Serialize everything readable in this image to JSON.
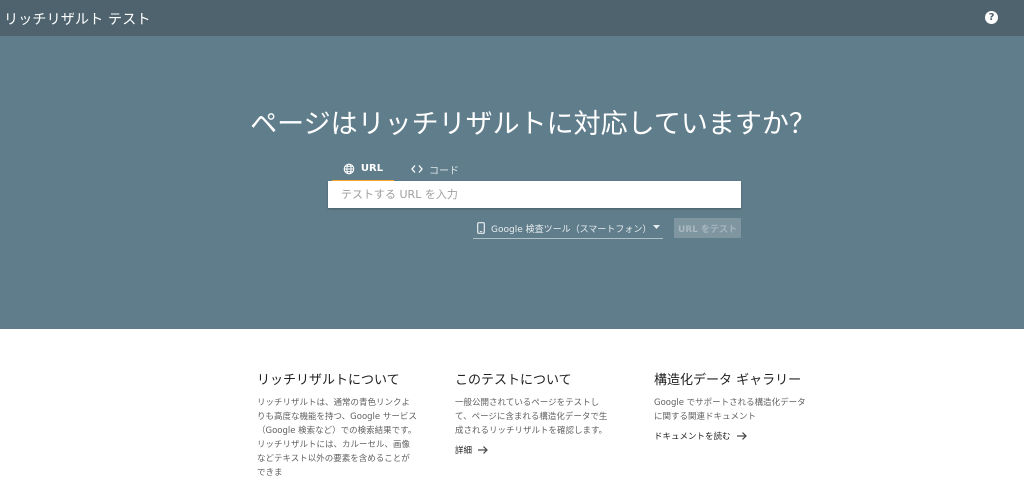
{
  "header": {
    "app_title": "リッチリザルト テスト",
    "help_icon": "help-circle-icon",
    "help_glyph": "?"
  },
  "hero": {
    "title": "ページはリッチリザルトに対応していますか？",
    "tabs": [
      {
        "label": "URL",
        "icon": "globe-icon",
        "active": true
      },
      {
        "label": "コード",
        "icon": "code-icon",
        "active": false
      }
    ],
    "url_input": {
      "placeholder": "テストする URL を入力",
      "value": ""
    },
    "device_select": {
      "selected": "Google 検査ツール（スマートフォン）",
      "icon": "smartphone-icon"
    },
    "test_button_label": "URL をテスト"
  },
  "info_sections": [
    {
      "title": "リッチリザルトについて",
      "body": "リッチリザルトは、通常の青色リンクよりも高度な機能を持つ、Google サービス（Google 検索など）での検索結果です。リッチリザルトには、カルーセル、画像などテキスト以外の要素を含めることができま"
    },
    {
      "title": "このテストについて",
      "body": "一般公開されているページをテストして、ページに含まれる構造化データで生成されるリッチリザルトを確認します。",
      "link": "詳細"
    },
    {
      "title": "構造化データ ギャラリー",
      "body": "Google でサポートされる構造化データに関する関連ドキュメント",
      "link": "ドキュメントを読む"
    }
  ],
  "colors": {
    "header_bg": "#4e636e",
    "hero_bg": "#607d8b",
    "tab_indicator": "#f9ab2d"
  }
}
